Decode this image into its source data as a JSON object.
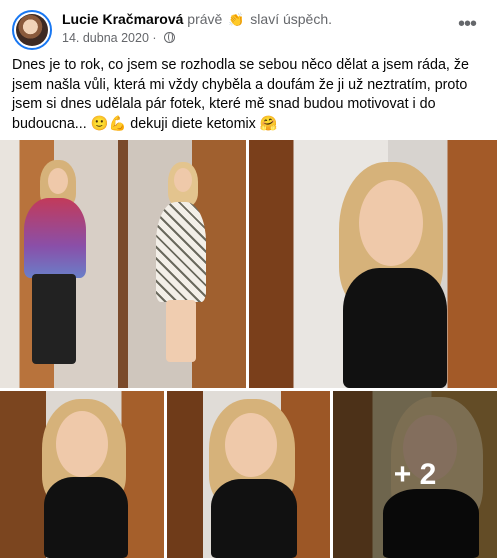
{
  "post": {
    "author": "Lucie Kračmarová",
    "activity_prefix": "právě",
    "activity_emoji": "👏",
    "activity_text": "slaví úspěch.",
    "date": "14. dubna 2020",
    "dot": "·",
    "privacy_icon": "globe-icon",
    "more_icon": "more-icon",
    "more_label": "•••",
    "text": "Dnes je to rok, co jsem se rozhodla se sebou něco dělat a jsem ráda, že jsem našla vůli, která mi vždy chyběla a doufám že ji už neztratím, proto jsem si dnes udělala pár fotek, které mě snad budou motivovat i do budoucna... 🙂💪 dekuji diete ketomix 🤗"
  },
  "photos": {
    "count": 5,
    "more_count_label": "+ 2"
  },
  "colors": {
    "link": "#1877f2",
    "muted": "#65676b",
    "text": "#050505"
  }
}
